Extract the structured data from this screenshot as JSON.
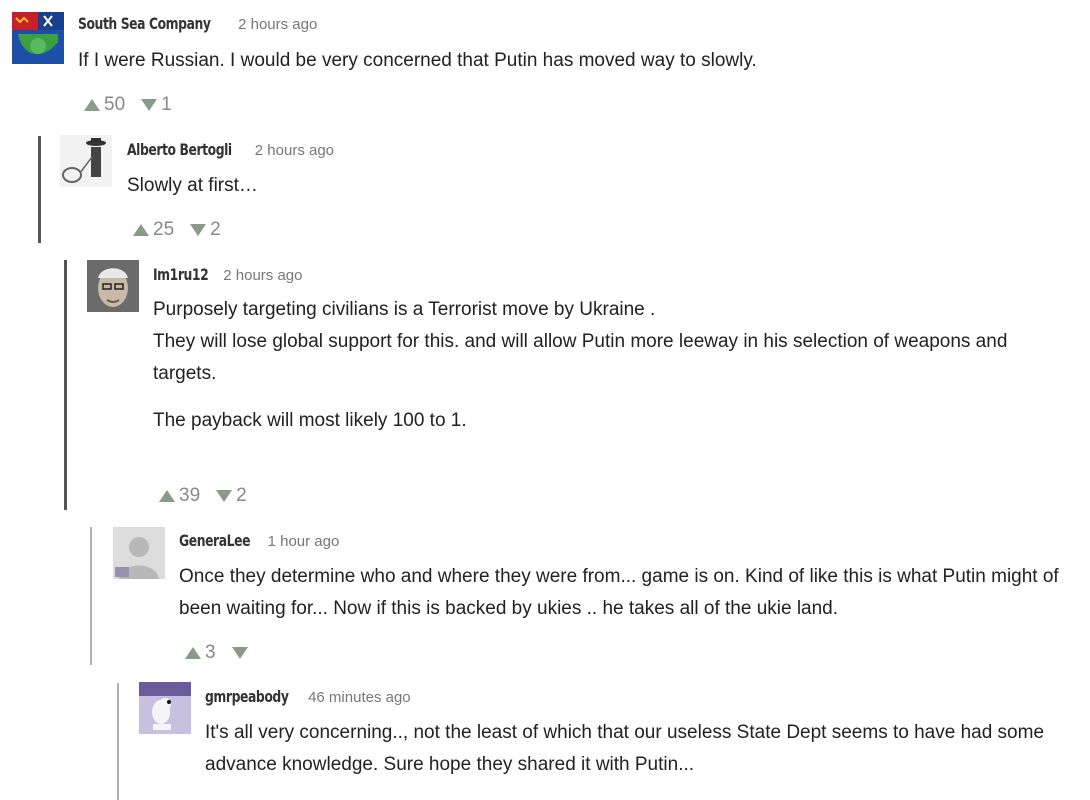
{
  "comments": [
    {
      "author": "South Sea Company",
      "time": "2 hours ago",
      "body": [
        "If I were Russian. I would be very concerned that Putin has moved way to slowly."
      ],
      "upvotes": "50",
      "downvotes": "1"
    },
    {
      "author": "Alberto Bertogli",
      "time": "2 hours ago",
      "body": [
        "Slowly at first…"
      ],
      "upvotes": "25",
      "downvotes": "2"
    },
    {
      "author": "Im1ru12",
      "time": "2 hours ago",
      "body": [
        "Purposely targeting civilians is a Terrorist move by Ukraine .",
        "They will lose global support for this. and will allow Putin more leeway in his selection of weapons and targets.",
        "The payback will most likely 100 to 1."
      ],
      "upvotes": "39",
      "downvotes": "2"
    },
    {
      "author": "GeneraLee",
      "time": "1 hour ago",
      "body": [
        "Once they determine who and where they were from... game is on. Kind of like this is what Putin might of been waiting for... Now if this is backed by ukies .. he takes all of the ukie land."
      ],
      "upvotes": "3",
      "downvotes": ""
    },
    {
      "author": "gmrpeabody",
      "time": "46 minutes ago",
      "body": [
        "It's all very concerning.., not the least of which that our useless State Dept seems to have had some advance knowledge. Sure hope they shared it with Putin..."
      ]
    }
  ],
  "icons": {
    "upvote": "upvote-triangle-icon",
    "downvote": "downvote-triangle-icon"
  },
  "colors": {
    "vote_arrow": "#8a9a8a",
    "rail_dark": "#555555",
    "rail_light": "#b0b0b0",
    "meta_text": "#777777"
  }
}
